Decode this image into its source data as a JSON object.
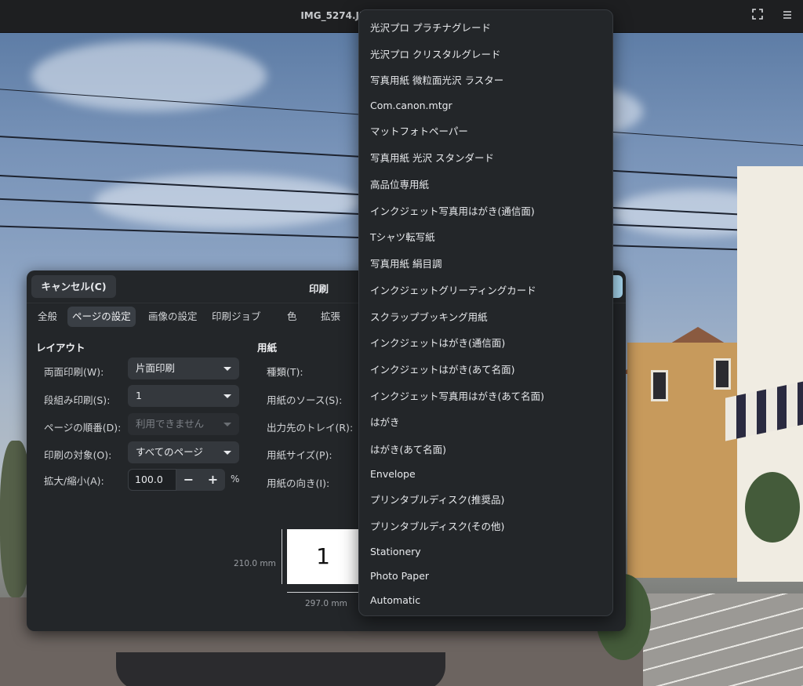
{
  "titlebar": {
    "title": "IMG_5274.JPG",
    "fullscreen_icon": "fullscreen-icon",
    "menu_icon": "hamburger-menu-icon"
  },
  "dialog": {
    "cancel_label": "キャンセル(C)",
    "title": "印刷",
    "tabs": [
      "全般",
      "ページの設定",
      "画像の設定",
      "印刷ジョブ",
      "色",
      "拡張"
    ],
    "active_tab": "ページの設定",
    "layout": {
      "heading": "レイアウト",
      "duplex_label": "両面印刷(W):",
      "duplex_value": "片面印刷",
      "nup_label": "段組み印刷(S):",
      "nup_value": "1",
      "order_label": "ページの順番(D):",
      "order_value": "利用できません",
      "pages_label": "印刷の対象(O):",
      "pages_value": "すべてのページ",
      "scale_label": "拡大/縮小(A):",
      "scale_value": "100.0",
      "scale_unit": "%",
      "minus": "−",
      "plus": "+"
    },
    "paper": {
      "heading": "用紙",
      "type_label": "種類(T):",
      "source_label": "用紙のソース(S):",
      "tray_label": "出力先のトレイ(R):",
      "size_label": "用紙サイズ(P):",
      "orientation_label": "用紙の向き(I):"
    },
    "preview": {
      "page_number": "1",
      "height_label": "210.0 mm",
      "width_label": "297.0 mm"
    }
  },
  "menu": {
    "items": [
      "光沢プロ プラチナグレード",
      "光沢プロ クリスタルグレード",
      "写真用紙 微粒面光沢 ラスター",
      "Com.canon.mtgr",
      "マットフォトペーパー",
      "写真用紙 光沢 スタンダード",
      "高品位専用紙",
      "インクジェット写真用はがき(通信面)",
      "Tシャツ転写紙",
      "写真用紙 絹目調",
      "インクジェットグリーティングカード",
      "スクラップブッキング用紙",
      "インクジェットはがき(通信面)",
      "インクジェットはがき(あて名面)",
      "インクジェット写真用はがき(あて名面)",
      "はがき",
      "はがき(あて名面)",
      "Envelope",
      "プリンタブルディスク(推奨品)",
      "プリンタブルディスク(その他)",
      "Stationery",
      "Photo Paper",
      "Automatic"
    ]
  }
}
